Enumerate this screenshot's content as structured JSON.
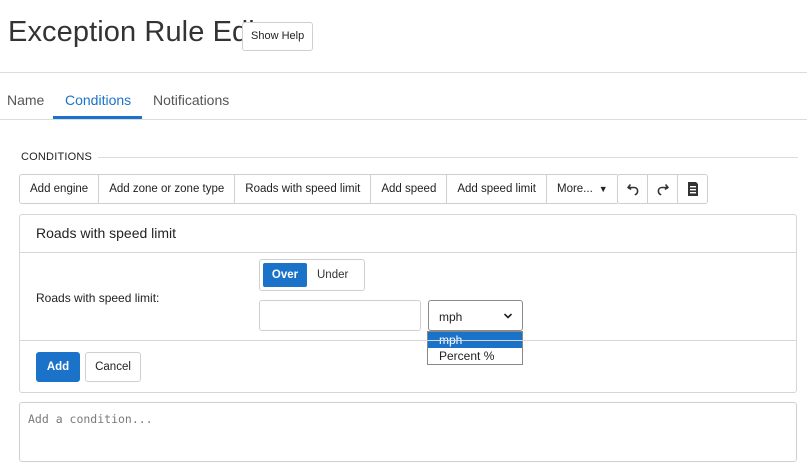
{
  "header": {
    "title": "Exception Rule Edit",
    "help_label": "Show Help"
  },
  "tabs": [
    {
      "label": "Name",
      "active": false
    },
    {
      "label": "Conditions",
      "active": true
    },
    {
      "label": "Notifications",
      "active": false
    }
  ],
  "conditions": {
    "legend": "CONDITIONS",
    "toolbar": [
      "Add engine",
      "Add zone or zone type",
      "Roads with speed limit",
      "Add speed",
      "Add speed limit",
      "More..."
    ],
    "icons": [
      "undo-icon",
      "redo-icon",
      "clipboard-icon"
    ],
    "panel": {
      "title": "Roads with speed limit",
      "field_label": "Roads with speed limit:",
      "toggle": {
        "options": [
          "Over",
          "Under"
        ],
        "selected": "Over"
      },
      "speed_value": "",
      "unit": {
        "selected": "mph",
        "options": [
          "mph",
          "Percent %"
        ],
        "highlighted": "mph"
      },
      "add_label": "Add",
      "cancel_label": "Cancel"
    },
    "add_condition_placeholder": "Add a condition..."
  },
  "colors": {
    "accent": "#1a73c8",
    "border": "#cfcfcf",
    "text": "#333333"
  }
}
